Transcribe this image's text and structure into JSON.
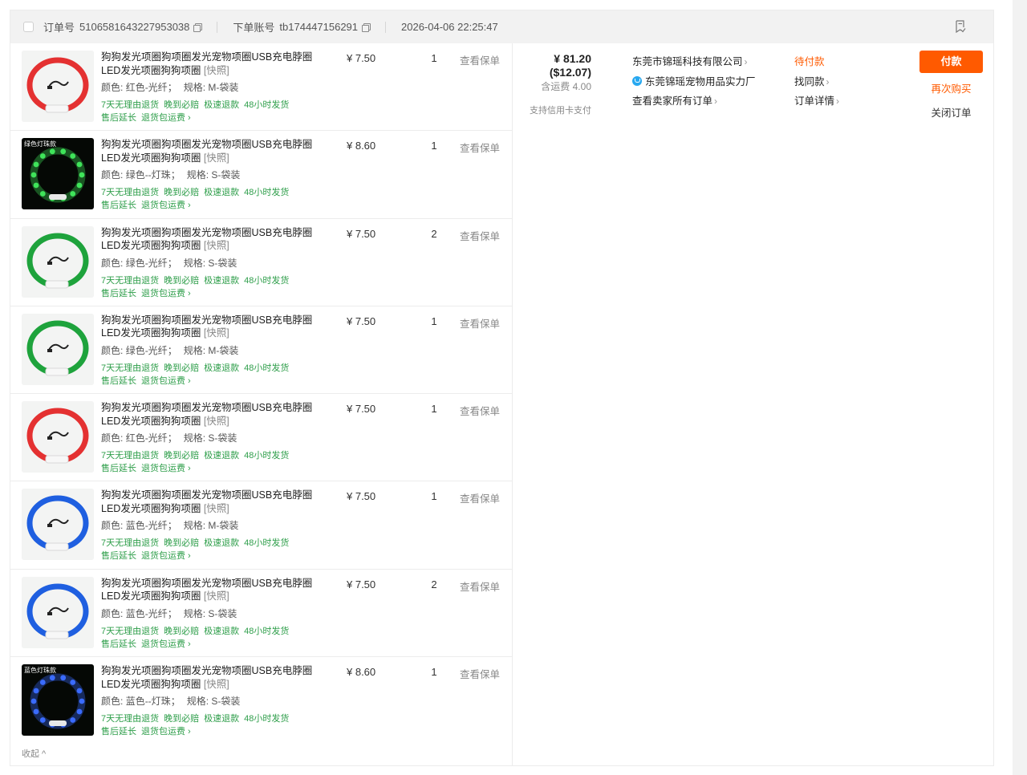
{
  "order": {
    "order_no_label": "订单号",
    "order_no": "5106581643227953038",
    "account_label": "下单账号",
    "account": "tb174447156291",
    "datetime": "2026-04-06 22:25:47"
  },
  "items": [
    {
      "title": "狗狗发光项圈狗项圈发光宠物项圈USB充电脖圈LED发光项圈狗狗项圈",
      "snapshot": "[快照]",
      "color_label": "颜色:",
      "color": "红色-光纤",
      "size_label": "规格:",
      "size": "M-袋装",
      "price": "¥ 7.50",
      "qty": "1",
      "warranty": "查看保单",
      "thumb_color": "#e43131",
      "thumb_style": "fiber",
      "thumb_text": ""
    },
    {
      "title": "狗狗发光项圈狗项圈发光宠物项圈USB充电脖圈LED发光项圈狗狗项圈",
      "snapshot": "[快照]",
      "color_label": "颜色:",
      "color": "绿色--灯珠",
      "size_label": "规格:",
      "size": "S-袋装",
      "price": "¥ 8.60",
      "qty": "1",
      "warranty": "查看保单",
      "thumb_color": "#3fe45a",
      "thumb_style": "beads",
      "thumb_text": "绿色灯珠款"
    },
    {
      "title": "狗狗发光项圈狗项圈发光宠物项圈USB充电脖圈LED发光项圈狗狗项圈",
      "snapshot": "[快照]",
      "color_label": "颜色:",
      "color": "绿色-光纤",
      "size_label": "规格:",
      "size": "S-袋装",
      "price": "¥ 7.50",
      "qty": "2",
      "warranty": "查看保单",
      "thumb_color": "#1ea33c",
      "thumb_style": "fiber",
      "thumb_text": ""
    },
    {
      "title": "狗狗发光项圈狗项圈发光宠物项圈USB充电脖圈LED发光项圈狗狗项圈",
      "snapshot": "[快照]",
      "color_label": "颜色:",
      "color": "绿色-光纤",
      "size_label": "规格:",
      "size": "M-袋装",
      "price": "¥ 7.50",
      "qty": "1",
      "warranty": "查看保单",
      "thumb_color": "#1ea33c",
      "thumb_style": "fiber",
      "thumb_text": ""
    },
    {
      "title": "狗狗发光项圈狗项圈发光宠物项圈USB充电脖圈LED发光项圈狗狗项圈",
      "snapshot": "[快照]",
      "color_label": "颜色:",
      "color": "红色-光纤",
      "size_label": "规格:",
      "size": "S-袋装",
      "price": "¥ 7.50",
      "qty": "1",
      "warranty": "查看保单",
      "thumb_color": "#e43131",
      "thumb_style": "fiber",
      "thumb_text": ""
    },
    {
      "title": "狗狗发光项圈狗项圈发光宠物项圈USB充电脖圈LED发光项圈狗狗项圈",
      "snapshot": "[快照]",
      "color_label": "颜色:",
      "color": "蓝色-光纤",
      "size_label": "规格:",
      "size": "M-袋装",
      "price": "¥ 7.50",
      "qty": "1",
      "warranty": "查看保单",
      "thumb_color": "#1f5fe0",
      "thumb_style": "fiber",
      "thumb_text": ""
    },
    {
      "title": "狗狗发光项圈狗项圈发光宠物项圈USB充电脖圈LED发光项圈狗狗项圈",
      "snapshot": "[快照]",
      "color_label": "颜色:",
      "color": "蓝色-光纤",
      "size_label": "规格:",
      "size": "S-袋装",
      "price": "¥ 7.50",
      "qty": "2",
      "warranty": "查看保单",
      "thumb_color": "#1f5fe0",
      "thumb_style": "fiber",
      "thumb_text": ""
    },
    {
      "title": "狗狗发光项圈狗项圈发光宠物项圈USB充电脖圈LED发光项圈狗狗项圈",
      "snapshot": "[快照]",
      "color_label": "颜色:",
      "color": "蓝色--灯珠",
      "size_label": "规格:",
      "size": "S-袋装",
      "price": "¥ 8.60",
      "qty": "1",
      "warranty": "查看保单",
      "thumb_color": "#3a6bff",
      "thumb_style": "beads",
      "thumb_text": "蓝色灯珠款"
    }
  ],
  "service_tags": [
    "7天无理由退货",
    "晚到必赔",
    "极速退款",
    "48小时发货"
  ],
  "service_tags_row2": [
    "售后延长",
    "退货包运费 ›"
  ],
  "collapse_label": "收起 ^",
  "summary": {
    "total": "¥ 81.20",
    "total_usd": "($12.07)",
    "shipping": "含运费 4.00",
    "credit_note": "支持信用卡支付"
  },
  "seller": {
    "company": "东莞市锦瑶科技有限公司",
    "shop": "东莞锦瑶宠物用品实力厂",
    "all_orders": "查看卖家所有订单"
  },
  "status": {
    "pending": "待付款",
    "find_similar": "找同款",
    "details": "订单详情"
  },
  "actions": {
    "pay": "付款",
    "rebuy": "再次购买",
    "close": "关闭订单"
  },
  "colors": {
    "accent": "#ff5a00",
    "tag_green": "#2e9e4a"
  }
}
